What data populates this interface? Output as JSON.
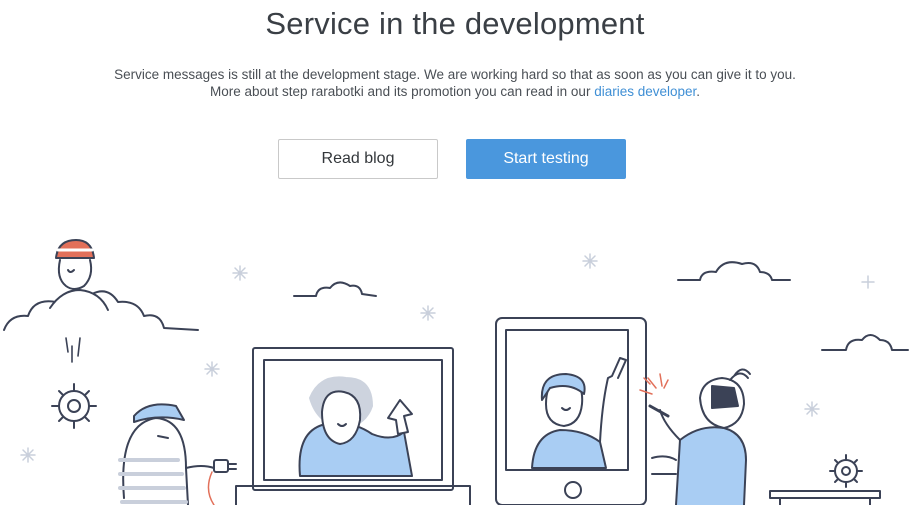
{
  "header": {
    "title": "Service in the development"
  },
  "description": {
    "line1": "Service messages is still at the development stage. We are working hard so that  as soon as you can give it to you.",
    "line2_prefix": "More about step rarabotki and its promotion you can read in our ",
    "line2_link": "diaries developer",
    "line2_suffix": "."
  },
  "actions": {
    "read_blog_label": "Read blog",
    "start_testing_label": "Start testing"
  },
  "colors": {
    "accent": "#4a97dd",
    "link": "#3f8fd5",
    "illustration_stroke": "#3b4256",
    "illustration_fill": "#a9cdf3",
    "helmet": "#e2705a"
  },
  "illustration": {
    "icons": [
      "cloud-icon",
      "gear-icon",
      "monitor-icon",
      "phone-icon",
      "sparkle-icon"
    ]
  }
}
